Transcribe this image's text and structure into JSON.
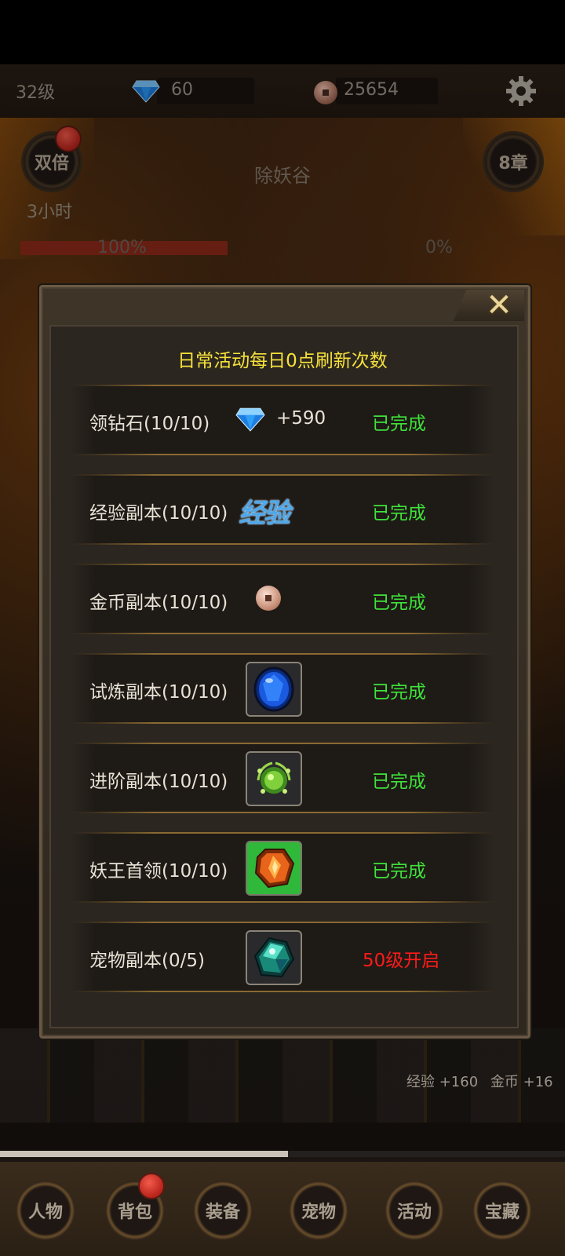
{
  "topbar": {
    "level": "32级",
    "diamonds": "60",
    "coins": "25654",
    "icons": [
      "diamond-icon",
      "coin-icon",
      "gear-icon"
    ]
  },
  "map": {
    "double_label": "双倍",
    "timer": "3小时",
    "title": "除妖谷",
    "chapter": "8章",
    "progress_left_pct": "100%",
    "progress_left_value": 1.0,
    "progress_right_pct": "0%"
  },
  "modal": {
    "heading": "日常活动每日0点刷新次数",
    "rows": [
      {
        "label": "领钻石(10/10)",
        "reward_amount": "+590",
        "reward_icon": "diamond-icon",
        "status": "已完成"
      },
      {
        "label": "经验副本(10/10)",
        "reward_text": "经验",
        "reward_icon": "exp-icon",
        "status": "已完成"
      },
      {
        "label": "金币副本(10/10)",
        "reward_icon": "coin-icon",
        "status": "已完成"
      },
      {
        "label": "试炼副本(10/10)",
        "reward_icon": "blue-gem-icon",
        "status": "已完成"
      },
      {
        "label": "进阶副本(10/10)",
        "reward_icon": "green-orb-icon",
        "status": "已完成"
      },
      {
        "label": "妖王首领(10/10)",
        "reward_icon": "orange-crystal-icon",
        "status": "已完成"
      },
      {
        "label": "宠物副本(0/5)",
        "reward_icon": "teal-crystal-icon",
        "status": "50级开启"
      }
    ],
    "colors": {
      "done": "#3fe23a",
      "locked": "#ff1a1a",
      "heading": "#f5e23a"
    }
  },
  "footer": {
    "exp_gain": "经验 +160",
    "gold_gain": "金币 +16",
    "xp_progress": 0.51
  },
  "nav": {
    "items": [
      "人物",
      "背包",
      "装备",
      "宠物",
      "活动",
      "宝藏"
    ]
  }
}
